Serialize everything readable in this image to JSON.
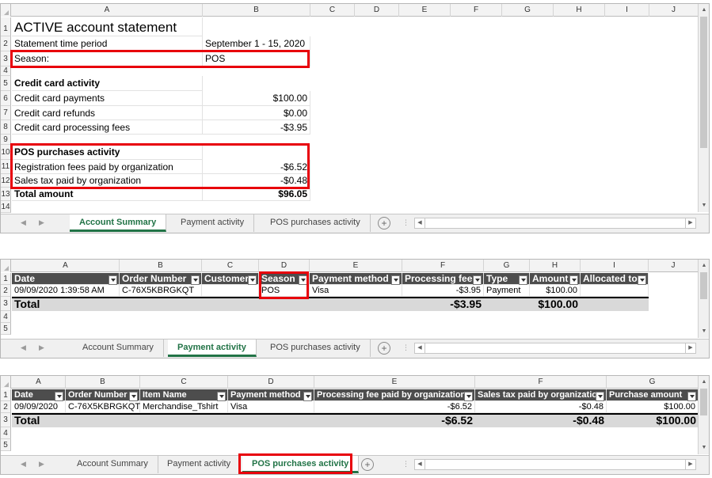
{
  "sheet1": {
    "col_headers": [
      "A",
      "B",
      "C",
      "D",
      "E",
      "F",
      "G",
      "H",
      "I",
      "J"
    ],
    "row_nums": [
      "1",
      "2",
      "3",
      "4",
      "5",
      "6",
      "7",
      "8",
      "9",
      "10",
      "11",
      "12",
      "13",
      "14"
    ],
    "title": "ACTIVE account statement",
    "rows": [
      {
        "label": "Statement time period",
        "value": "September 1 - 15, 2020"
      },
      {
        "label": "Season:",
        "value": "POS"
      },
      {
        "label": "",
        "value": ""
      },
      {
        "label": "Credit card activity",
        "value": ""
      },
      {
        "label": "Credit card payments",
        "value": "$100.00"
      },
      {
        "label": "Credit card refunds",
        "value": "$0.00"
      },
      {
        "label": "Credit card processing fees",
        "value": "-$3.95"
      },
      {
        "label": "",
        "value": ""
      },
      {
        "label": "POS purchases activity",
        "value": ""
      },
      {
        "label": "Registration fees paid by organization",
        "value": "-$6.52"
      },
      {
        "label": "Sales tax paid by organization",
        "value": "-$0.48"
      },
      {
        "label": "Total amount",
        "value": "$96.05"
      },
      {
        "label": "",
        "value": ""
      }
    ]
  },
  "sheet2": {
    "col_headers": [
      "A",
      "B",
      "C",
      "D",
      "E",
      "F",
      "G",
      "H",
      "I",
      "J"
    ],
    "row_nums": [
      "1",
      "2",
      "3",
      "4",
      "5"
    ],
    "headers": [
      "Date",
      "Order Number",
      "Customer",
      "Season",
      "Payment method",
      "Processing fee",
      "Type",
      "Amount",
      "Allocated to"
    ],
    "data_row": [
      "09/09/2020 1:39:58 AM",
      "C-76X5KBRGKQT",
      "",
      "POS",
      "Visa",
      "-$3.95",
      "Payment",
      "$100.00",
      ""
    ],
    "total_label": "Total",
    "total_fee": "-$3.95",
    "total_amount": "$100.00"
  },
  "sheet3": {
    "col_headers": [
      "A",
      "B",
      "C",
      "D",
      "E",
      "F",
      "G"
    ],
    "row_nums": [
      "1",
      "2",
      "3",
      "4",
      "5"
    ],
    "headers": [
      "Date",
      "Order Number",
      "Item Name",
      "Payment method",
      "Processing fee paid by organization",
      "Sales tax paid by organization",
      "Purchase amount"
    ],
    "data_row": [
      "09/09/2020",
      "C-76X5KBRGKQT",
      "Merchandise_Tshirt",
      "Visa",
      "-$6.52",
      "-$0.48",
      "$100.00"
    ],
    "total_label": "Total",
    "total_fee": "-$6.52",
    "total_tax": "-$0.48",
    "total_amount": "$100.00"
  },
  "tabs": [
    "Account Summary",
    "Payment activity",
    "POS purchases activity"
  ],
  "icons": {
    "add_sheet": "plus-circle-icon",
    "nav_prev": "triangle-left-icon",
    "nav_next": "triangle-right-icon"
  },
  "colors": {
    "accent": "#217346",
    "highlight": "#e8000b",
    "table_header": "#4d4d4d"
  }
}
